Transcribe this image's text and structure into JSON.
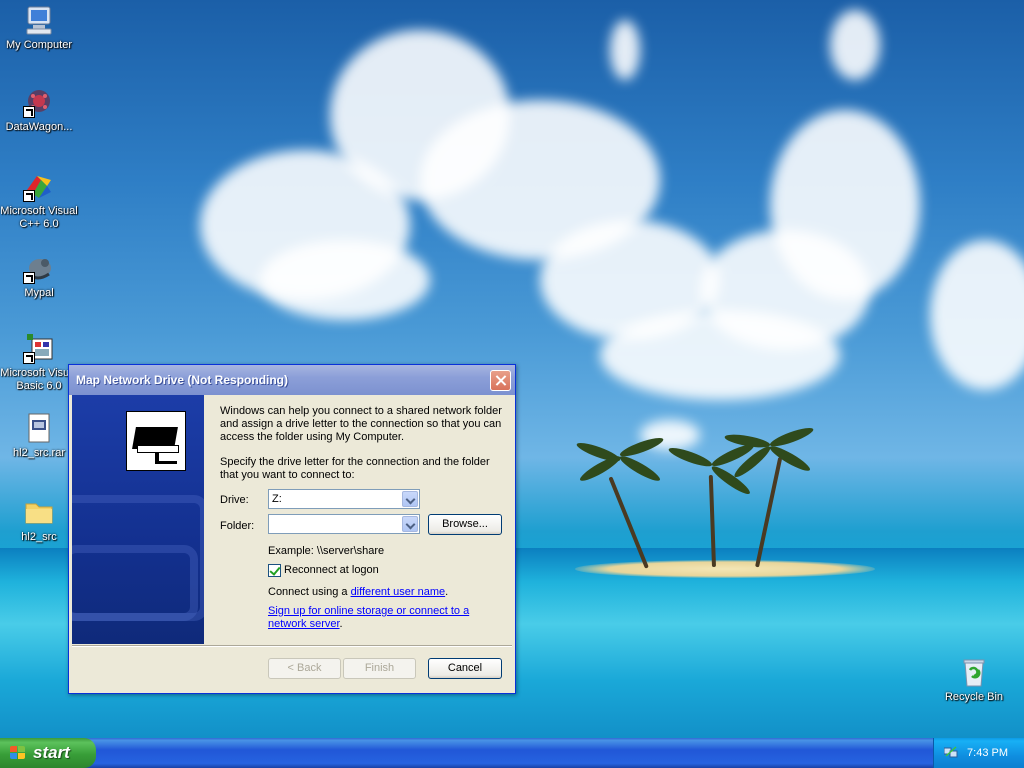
{
  "desktop": {
    "icons": [
      {
        "label": "My Computer"
      },
      {
        "label": "DataWagon..."
      },
      {
        "label": "Microsoft Visual C++ 6.0"
      },
      {
        "label": "Mypal"
      },
      {
        "label": "Microsoft Visual Basic 6.0"
      },
      {
        "label": "hl2_src.rar"
      },
      {
        "label": "hl2_src"
      },
      {
        "label": "Recycle Bin"
      }
    ]
  },
  "dialog": {
    "title": "Map Network Drive (Not Responding)",
    "intro": "Windows can help you connect to a shared network folder and assign a drive letter to the connection so that you can access the folder using My Computer.",
    "instruction": "Specify the drive letter for the connection and the folder that you want to connect to:",
    "drive_label": "Drive:",
    "drive_value": "Z:",
    "folder_label": "Folder:",
    "folder_value": "",
    "browse_label": "Browse...",
    "example": "Example: \\\\server\\share",
    "reconnect_label": "Reconnect at logon",
    "reconnect_checked": true,
    "connect_prefix": "Connect using a ",
    "connect_link": "different user name",
    "connect_suffix": ".",
    "signup_link": "Sign up for online storage or connect to a network server",
    "signup_suffix": ".",
    "back_label": "< Back",
    "finish_label": "Finish",
    "cancel_label": "Cancel"
  },
  "taskbar": {
    "start_label": "start",
    "clock": "7:43 PM"
  },
  "colors": {
    "taskbar_blue": "#2157d7",
    "start_green": "#389e38",
    "dialog_face": "#ece9d8",
    "link_blue": "#0000ff"
  }
}
